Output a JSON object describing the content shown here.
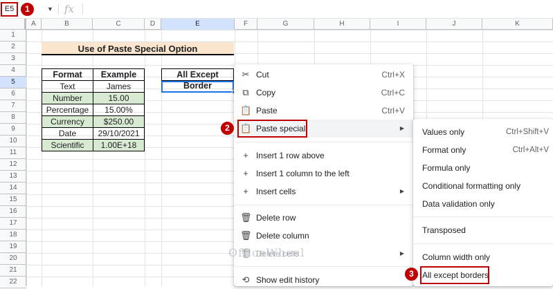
{
  "formula_bar": {
    "name_box": "E5",
    "fx": "fx"
  },
  "steps": [
    "1",
    "2",
    "3"
  ],
  "columns": [
    "A",
    "B",
    "C",
    "D",
    "E",
    "F",
    "G",
    "H",
    "I",
    "J",
    "K"
  ],
  "rows": [
    "1",
    "2",
    "3",
    "4",
    "5",
    "6",
    "7",
    "8",
    "9",
    "10",
    "11",
    "12",
    "13",
    "14",
    "15",
    "16",
    "17",
    "18",
    "19",
    "20",
    "21",
    "22"
  ],
  "sheet": {
    "title": "Use of Paste Special Option",
    "table_headers": [
      "Format",
      "Example"
    ],
    "table_rows": [
      [
        "Text",
        "James"
      ],
      [
        "Number",
        "15.00"
      ],
      [
        "Percentage",
        "15.00%"
      ],
      [
        "Currency",
        "$250.00"
      ],
      [
        "Date",
        "29/10/2021"
      ],
      [
        "Scientific",
        "1.00E+18"
      ]
    ],
    "e_header": "All Except Border"
  },
  "menu": {
    "cut": {
      "label": "Cut",
      "shortcut": "Ctrl+X"
    },
    "copy": {
      "label": "Copy",
      "shortcut": "Ctrl+C"
    },
    "paste": {
      "label": "Paste",
      "shortcut": "Ctrl+V"
    },
    "paste_special": {
      "label": "Paste special"
    },
    "insert_row": {
      "label": "Insert 1 row above"
    },
    "insert_col": {
      "label": "Insert 1 column to the left"
    },
    "insert_cells": {
      "label": "Insert cells"
    },
    "delete_row": {
      "label": "Delete row"
    },
    "delete_col": {
      "label": "Delete column"
    },
    "delete_cells": {
      "label": "Delete cells"
    },
    "history": {
      "label": "Show edit history"
    }
  },
  "submenu": {
    "values_only": {
      "label": "Values only",
      "shortcut": "Ctrl+Shift+V"
    },
    "format_only": {
      "label": "Format only",
      "shortcut": "Ctrl+Alt+V"
    },
    "formula_only": {
      "label": "Formula only"
    },
    "cond_format": {
      "label": "Conditional formatting only"
    },
    "data_validation": {
      "label": "Data validation only"
    },
    "transposed": {
      "label": "Transposed"
    },
    "col_width": {
      "label": "Column width only"
    },
    "all_except_borders": {
      "label": "All except borders"
    }
  },
  "watermark": "OfficeWheel",
  "colors": {
    "annotation_red": "#c00000",
    "selection_blue": "#1a73e8",
    "title_fill": "#fce5cd",
    "alt_row_fill": "#d9ead3"
  }
}
